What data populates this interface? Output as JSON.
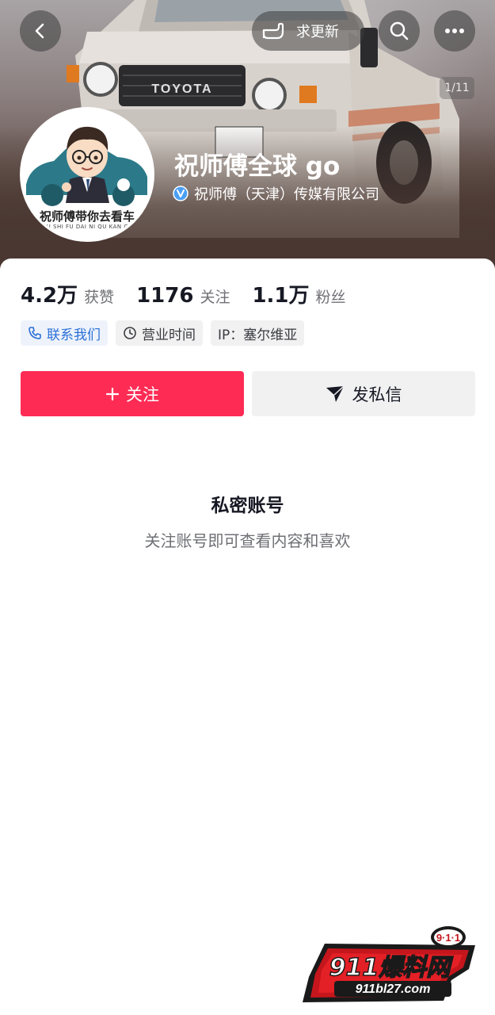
{
  "header": {
    "update_label": "求更新",
    "photo_counter": "1/11"
  },
  "profile": {
    "nickname": "祝师傅全球 go",
    "verification": "祝师傅（天津）传媒有限公司",
    "avatar_caption": "祝师傅带你去看车",
    "avatar_subcaption": "ZHU SHI FU DAI NI QU KAN CHE"
  },
  "stats": [
    {
      "value": "4.2万",
      "label": "获赞"
    },
    {
      "value": "1176",
      "label": "关注"
    },
    {
      "value": "1.1万",
      "label": "粉丝"
    }
  ],
  "tags": {
    "contact": "联系我们",
    "hours": "营业时间",
    "ip": "IP：塞尔维亚"
  },
  "actions": {
    "follow": "关注",
    "message": "发私信"
  },
  "private": {
    "title": "私密账号",
    "description": "关注账号即可查看内容和喜欢"
  },
  "watermark": {
    "badge": "9·1·1",
    "brand": "911爆料网",
    "url": "911bl27.com"
  },
  "colors": {
    "accent": "#fe2c55",
    "contact_blue": "#2a6fd6",
    "verify_blue": "#4a9ff5"
  }
}
